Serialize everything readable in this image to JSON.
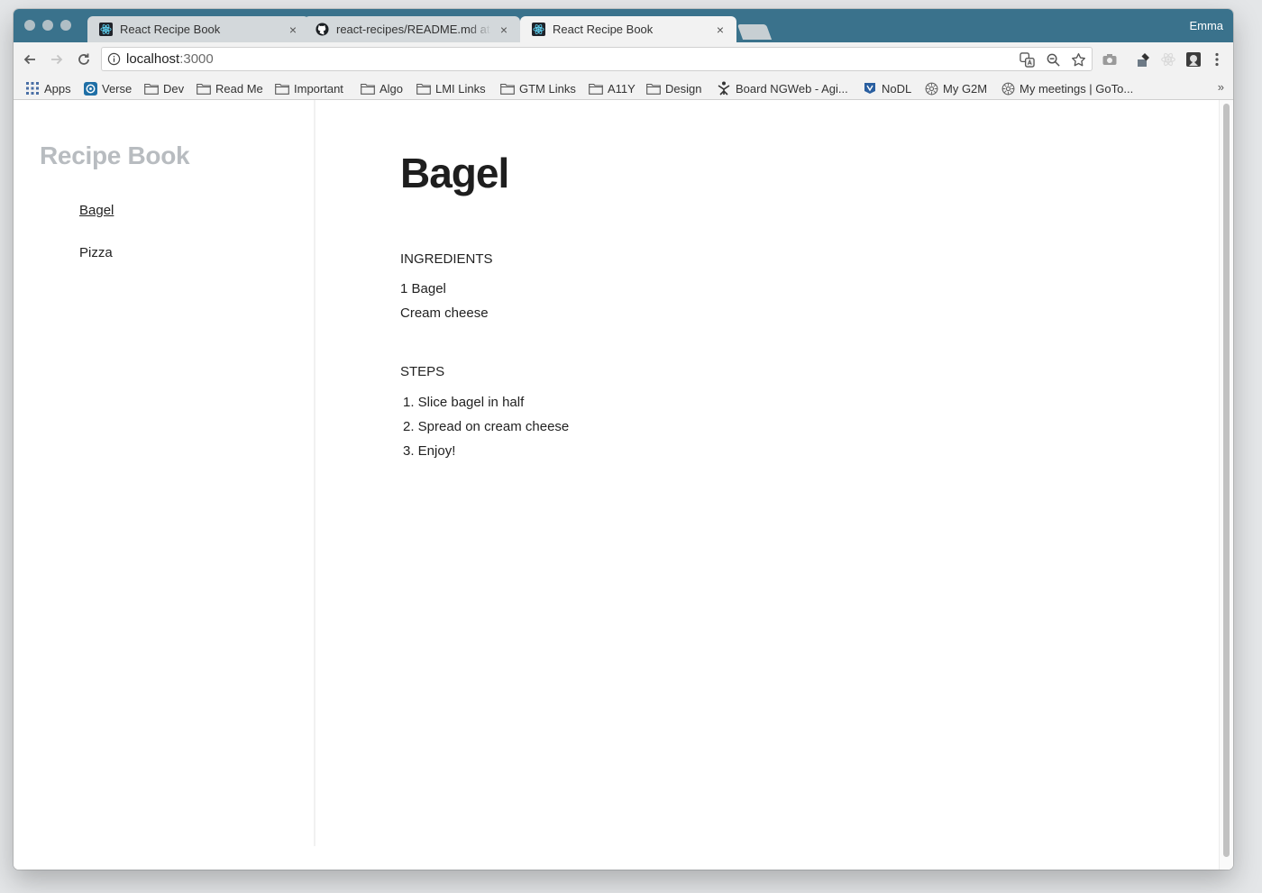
{
  "browser": {
    "tabs": [
      {
        "title": "React Recipe Book",
        "active": false,
        "favicon": "react-icon"
      },
      {
        "title": "react-recipes/README.md at r",
        "active": false,
        "favicon": "github-icon"
      },
      {
        "title": "React Recipe Book",
        "active": true,
        "favicon": "react-icon"
      }
    ],
    "profile_name": "Emma",
    "url_host": "localhost",
    "url_port": ":3000",
    "bookmarks": [
      {
        "label": "Apps",
        "icon": "apps-grid-icon"
      },
      {
        "label": "Verse",
        "icon": "verse-icon"
      },
      {
        "label": "Dev",
        "icon": "folder-icon"
      },
      {
        "label": "Read Me",
        "icon": "folder-icon"
      },
      {
        "label": "Important",
        "icon": "folder-icon"
      },
      {
        "label": "Algo",
        "icon": "folder-icon"
      },
      {
        "label": "LMI Links",
        "icon": "folder-icon"
      },
      {
        "label": "GTM Links",
        "icon": "folder-icon"
      },
      {
        "label": "A11Y",
        "icon": "folder-icon"
      },
      {
        "label": "Design",
        "icon": "folder-icon"
      },
      {
        "label": "Board NGWeb - Agi...",
        "icon": "board-icon"
      },
      {
        "label": "NoDL",
        "icon": "nodl-icon"
      },
      {
        "label": "My G2M",
        "icon": "gear-badge-icon"
      },
      {
        "label": "My meetings | GoTo...",
        "icon": "gear-badge-icon"
      }
    ],
    "bookmarks_overflow": "»"
  },
  "app": {
    "brand": "Recipe Book",
    "nav": [
      {
        "label": "Bagel",
        "current": true
      },
      {
        "label": "Pizza",
        "current": false
      }
    ],
    "recipe": {
      "title": "Bagel",
      "ingredients_heading": "INGREDIENTS",
      "ingredients": [
        "1 Bagel",
        "Cream cheese"
      ],
      "steps_heading": "STEPS",
      "steps": [
        "1. Slice bagel in half",
        "2. Spread on cream cheese",
        "3. Enjoy!"
      ]
    }
  },
  "colors": {
    "tabstrip": "#3a728c",
    "brand_text": "#b8bcc0"
  }
}
